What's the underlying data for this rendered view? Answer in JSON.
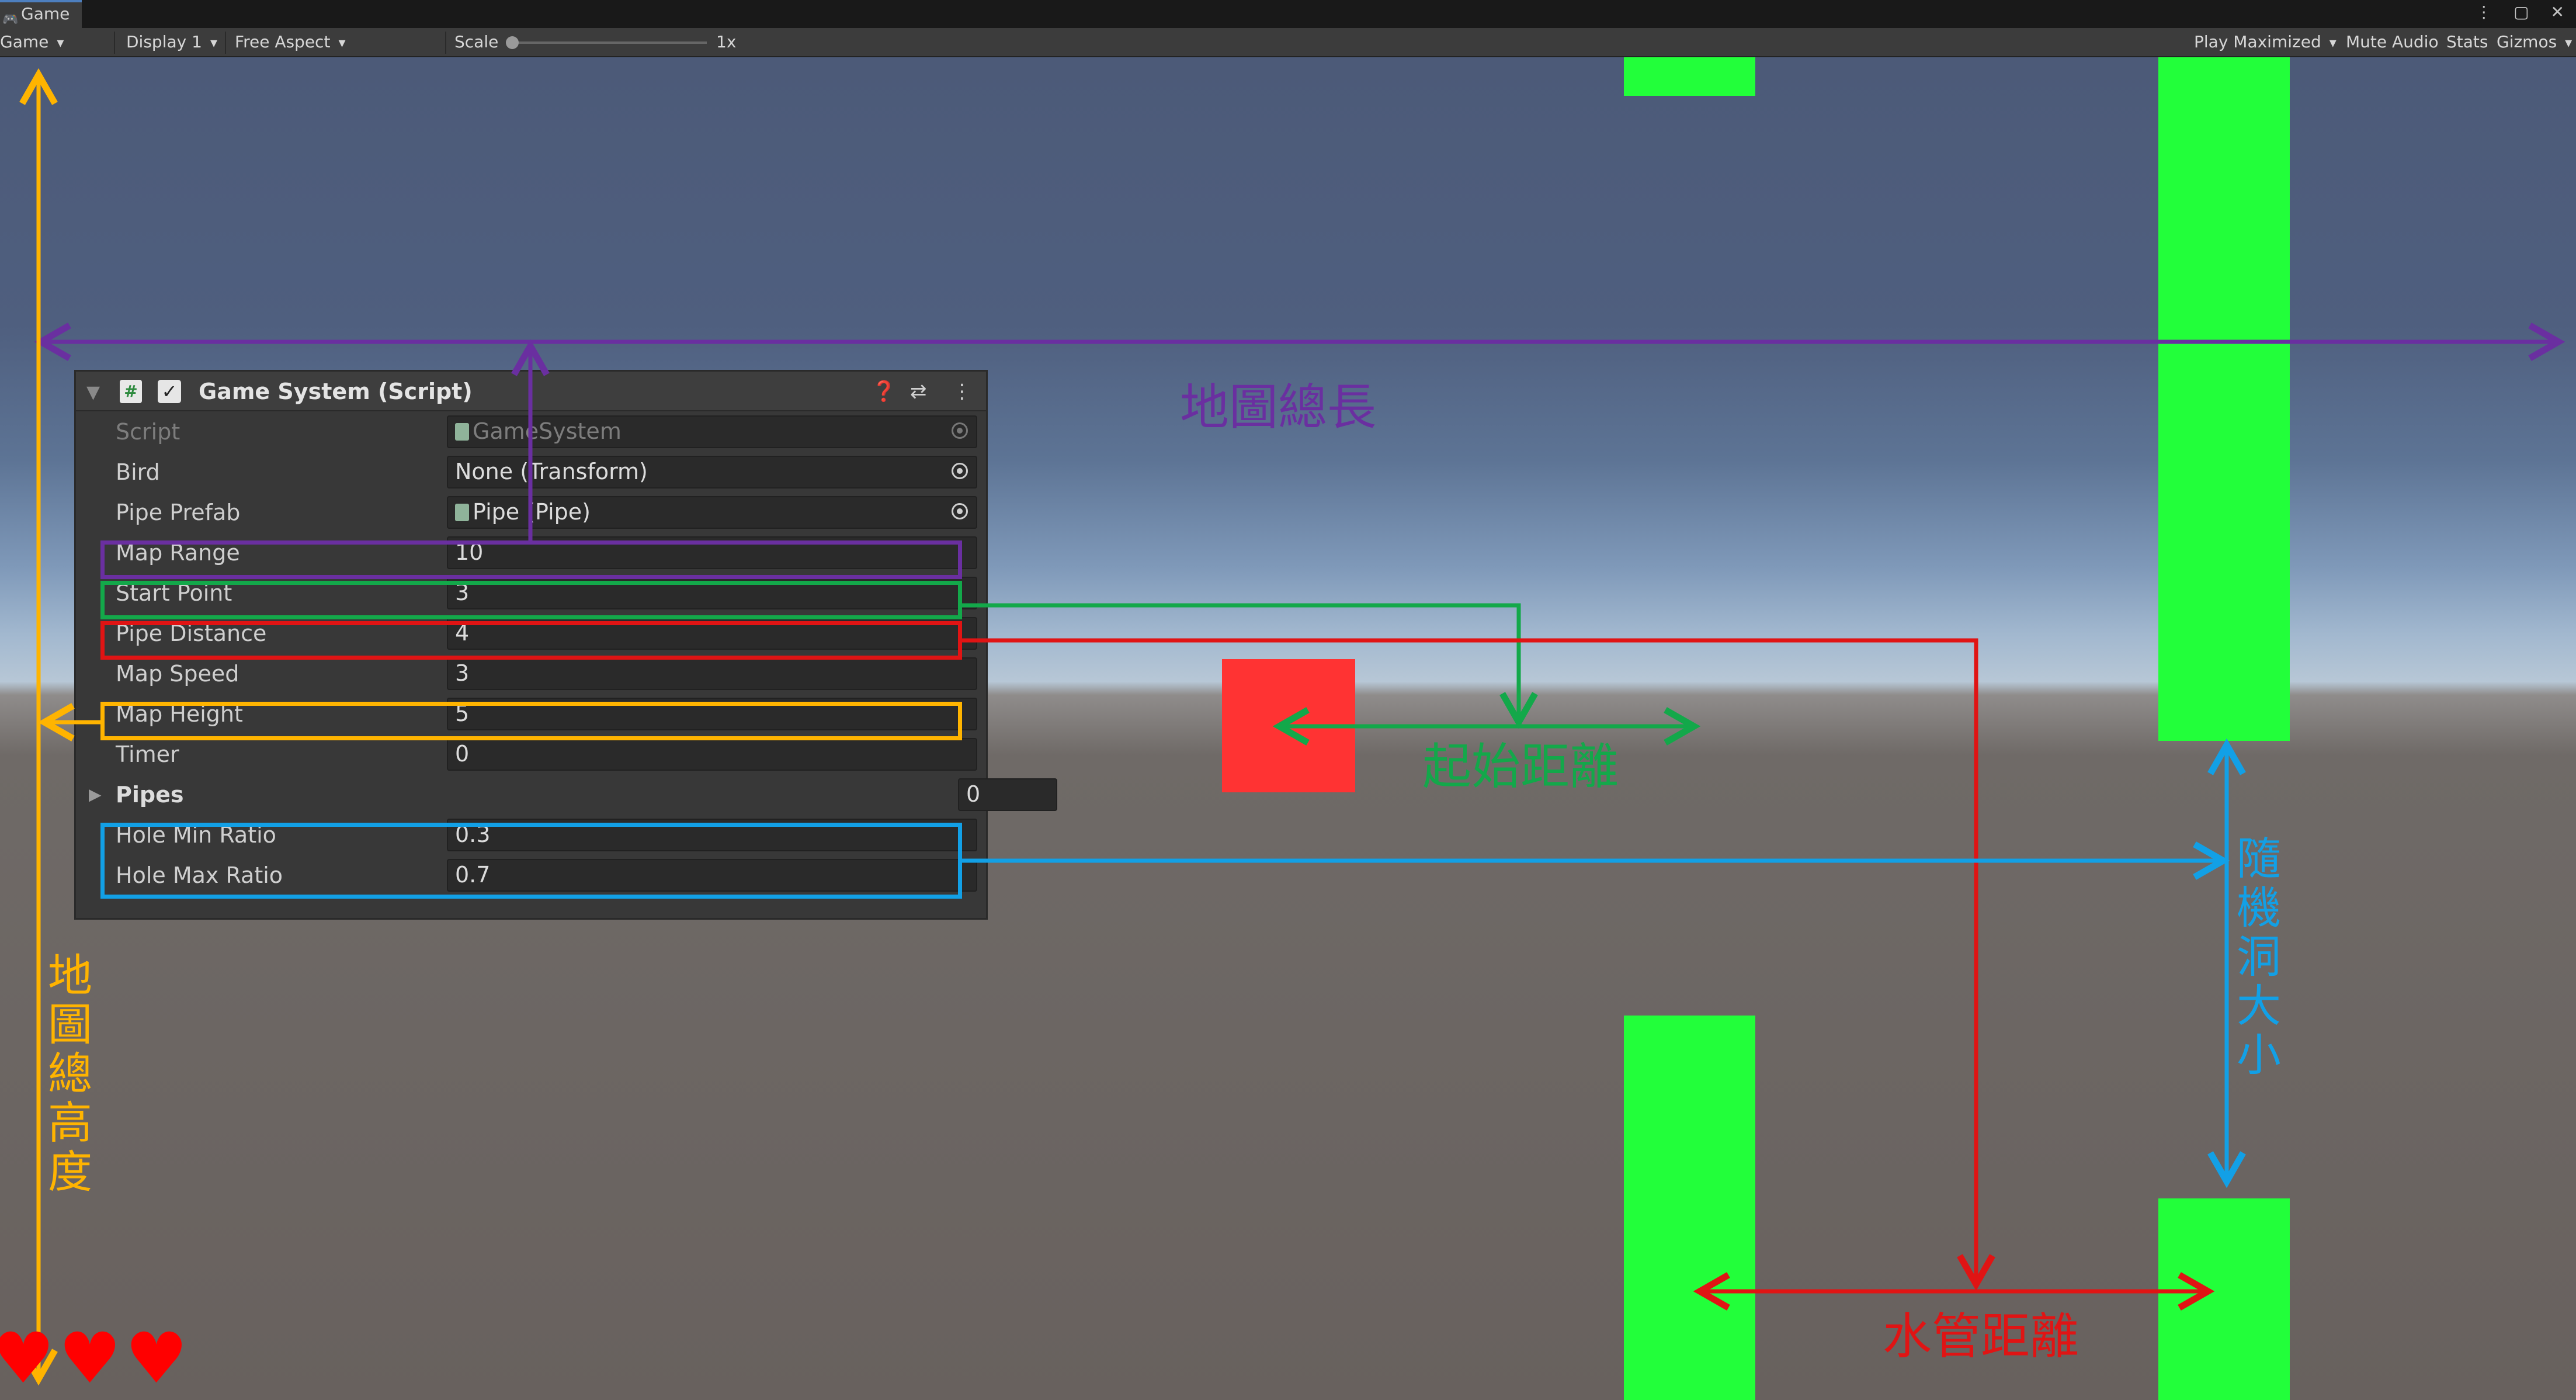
{
  "window": {
    "tab_label": "Game",
    "window_buttons": "⋮ ▢ ✕"
  },
  "toolbar": {
    "game_view_label": "Game",
    "display_label": "Display 1",
    "aspect_label": "Free Aspect",
    "scale_label": "Scale",
    "scale_value": "1x",
    "scale_fraction": 0.0,
    "play_maximized_label": "Play Maximized",
    "mute_audio_label": "Mute Audio",
    "stats_label": "Stats",
    "gizmos_label": "Gizmos"
  },
  "inspector": {
    "title": "Game System (Script)",
    "help_icon": "help-icon",
    "settings_icon": "preset-icon",
    "menu_icon": "kebab-menu-icon",
    "rows": [
      {
        "label": "Script",
        "value": "GameSystem"
      },
      {
        "label": "Bird",
        "value": "None (Transform)"
      },
      {
        "label": "Pipe Prefab",
        "value": "Pipe (Pipe)"
      },
      {
        "label": "Map Range",
        "value": "10"
      },
      {
        "label": "Start Point",
        "value": "3"
      },
      {
        "label": "Pipe Distance",
        "value": "4"
      },
      {
        "label": "Map Speed",
        "value": "3"
      },
      {
        "label": "Map Height",
        "value": "5"
      },
      {
        "label": "Timer",
        "value": "0"
      },
      {
        "label": "Pipes",
        "value": "0"
      },
      {
        "label": "Hole Min Ratio",
        "value": "0.3"
      },
      {
        "label": "Hole Max Ratio",
        "value": "0.7"
      }
    ]
  },
  "annotations": {
    "map_total_length": "地圖總長",
    "map_total_height": "地圖總高度",
    "start_distance": "起始距離",
    "pipe_distance": "水管距離",
    "random_hole_size": "隨機洞大小"
  },
  "hud": {
    "lives": 3
  },
  "colors": {
    "purple": "#6a2fa0",
    "green": "#13a84a",
    "red": "#e01414",
    "yellow": "#ffb400",
    "blue": "#12a0e6",
    "pipe_green": "#22ff3a",
    "bird_red": "#ff3333"
  }
}
